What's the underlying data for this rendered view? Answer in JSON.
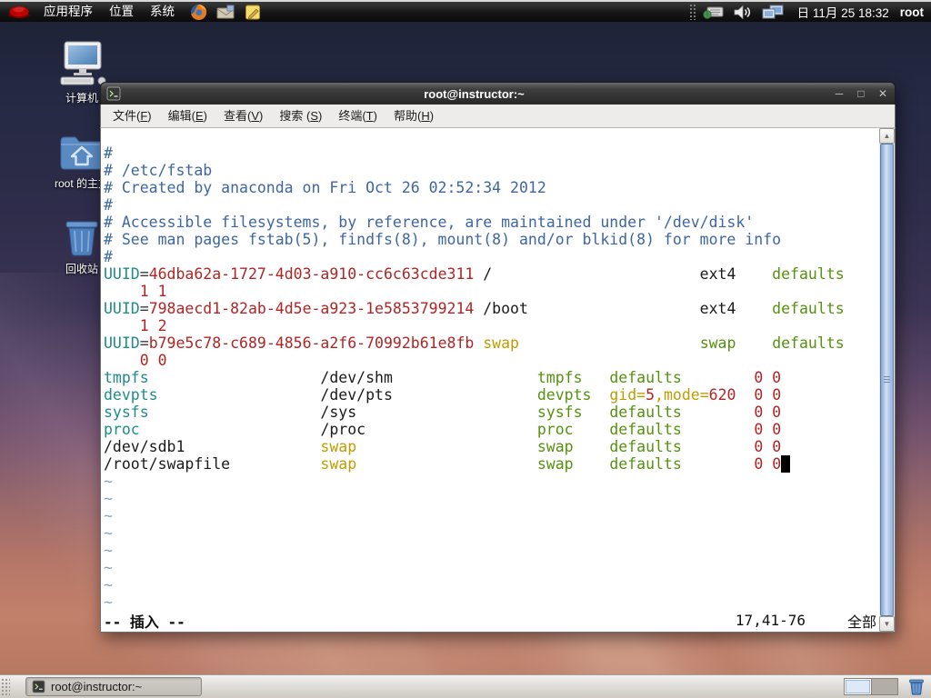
{
  "colors": {
    "comment": "#3e66a0",
    "keyword_cyan": "#1f8b8b",
    "value_red": "#b22424",
    "option_yellow": "#c09c00",
    "type_green": "#55920e",
    "plain_text": "#1a1a1a",
    "nontext_blue": "#8ca3c3",
    "terminal_bg": "#ffffff",
    "titlebar_bg": "#2f2f2f",
    "panel_bg": "#161616",
    "scroll_thumb": "#9cb6dd"
  },
  "top_panel": {
    "menus": [
      {
        "label": "应用程序"
      },
      {
        "label": "位置"
      },
      {
        "label": "系统"
      }
    ],
    "launchers": [
      "redhat-menu-icon",
      "firefox-icon",
      "mail-icon",
      "notes-icon"
    ],
    "tray": [
      "input-method-icon",
      "volume-icon",
      "display-icon"
    ],
    "clock": "日 11月 25 18:32",
    "user": "root"
  },
  "desktop_icons": [
    {
      "label": "计算机"
    },
    {
      "label": "root 的主文"
    },
    {
      "label": "回收站"
    }
  ],
  "terminal": {
    "title": "root@instructor:~",
    "window_buttons": {
      "minimize": "─",
      "maximize": "□",
      "close": "✕"
    },
    "menu": [
      {
        "label": "文件(F)"
      },
      {
        "label": "编辑(E)"
      },
      {
        "label": "查看(V)"
      },
      {
        "label": "搜索 (S)"
      },
      {
        "label": "终端(T)"
      },
      {
        "label": "帮助(H)"
      }
    ],
    "status": {
      "mode": "-- 插入 --",
      "ruler": "17,41-76",
      "position": "全部"
    }
  },
  "vim_rows": [
    [
      [
        "c",
        "#"
      ]
    ],
    [
      [
        "c",
        "# /etc/fstab"
      ]
    ],
    [
      [
        "c",
        "# Created by anaconda on Fri Oct 26 02:52:34 2012"
      ]
    ],
    [
      [
        "c",
        "#"
      ]
    ],
    [
      [
        "c",
        "# Accessible filesystems, by reference, are maintained under '/dev/disk'"
      ]
    ],
    [
      [
        "c",
        "# See man pages fstab(5), findfs(8), mount(8) and/or blkid(8) for more info"
      ]
    ],
    [
      [
        "c",
        "#"
      ]
    ],
    [
      [
        "k",
        "UUID"
      ],
      [
        "d",
        "="
      ],
      [
        "r",
        "46dba62a-1727-4d03-a910-cc6c63cde311"
      ],
      [
        "b",
        " /"
      ],
      [
        "b",
        "ext4",
        66
      ],
      [
        "g",
        "defaults",
        74
      ]
    ],
    [
      [
        "r",
        "1 1",
        4
      ]
    ],
    [
      [
        "k",
        "UUID"
      ],
      [
        "d",
        "="
      ],
      [
        "r",
        "798aecd1-82ab-4d5e-a923-1e5853799214"
      ],
      [
        "b",
        " /boot"
      ],
      [
        "b",
        "ext4",
        66
      ],
      [
        "g",
        "defaults",
        74
      ]
    ],
    [
      [
        "r",
        "1 2",
        4
      ]
    ],
    [
      [
        "k",
        "UUID"
      ],
      [
        "d",
        "="
      ],
      [
        "r",
        "b79e5c78-c689-4856-a2f6-70992b61e8fb"
      ],
      [
        "y",
        "swap",
        42
      ],
      [
        "g",
        "swap",
        66
      ],
      [
        "g",
        "defaults",
        74
      ]
    ],
    [
      [
        "r",
        "0 0",
        4
      ]
    ],
    [
      [
        "k",
        "tmpfs"
      ],
      [
        "b",
        "/dev/shm",
        24
      ],
      [
        "g",
        "tmpfs",
        48
      ],
      [
        "g",
        "defaults",
        56
      ],
      [
        "r",
        "0 0",
        72
      ]
    ],
    [
      [
        "k",
        "devpts"
      ],
      [
        "b",
        "/dev/pts",
        24
      ],
      [
        "g",
        "devpts",
        48
      ],
      [
        "y",
        "gid=",
        56
      ],
      [
        "r",
        "5"
      ],
      [
        "y",
        ",mode="
      ],
      [
        "r",
        "620"
      ],
      [
        "r",
        "0 0",
        72
      ]
    ],
    [
      [
        "k",
        "sysfs"
      ],
      [
        "b",
        "/sys",
        24
      ],
      [
        "g",
        "sysfs",
        48
      ],
      [
        "g",
        "defaults",
        56
      ],
      [
        "r",
        "0 0",
        72
      ]
    ],
    [
      [
        "k",
        "proc"
      ],
      [
        "b",
        "/proc",
        24
      ],
      [
        "g",
        "proc",
        48
      ],
      [
        "g",
        "defaults",
        56
      ],
      [
        "r",
        "0 0",
        72
      ]
    ],
    [
      [
        "b",
        "/dev/sdb1"
      ],
      [
        "y",
        "swap",
        24
      ],
      [
        "g",
        "swap",
        48
      ],
      [
        "g",
        "defaults",
        56
      ],
      [
        "r",
        "0 0",
        72
      ]
    ],
    [
      [
        "b",
        "/root/swapfile"
      ],
      [
        "y",
        "swap",
        24
      ],
      [
        "g",
        "swap",
        48
      ],
      [
        "g",
        "defaults",
        56
      ],
      [
        "r",
        "0 0",
        72
      ],
      [
        "x",
        " "
      ]
    ],
    [
      [
        "n",
        "~"
      ]
    ],
    [
      [
        "n",
        "~"
      ]
    ],
    [
      [
        "n",
        "~"
      ]
    ],
    [
      [
        "n",
        "~"
      ]
    ],
    [
      [
        "n",
        "~"
      ]
    ],
    [
      [
        "n",
        "~"
      ]
    ],
    [
      [
        "n",
        "~"
      ]
    ],
    [
      [
        "n",
        "~"
      ]
    ]
  ],
  "taskbar": {
    "task_label": "root@instructor:~"
  }
}
